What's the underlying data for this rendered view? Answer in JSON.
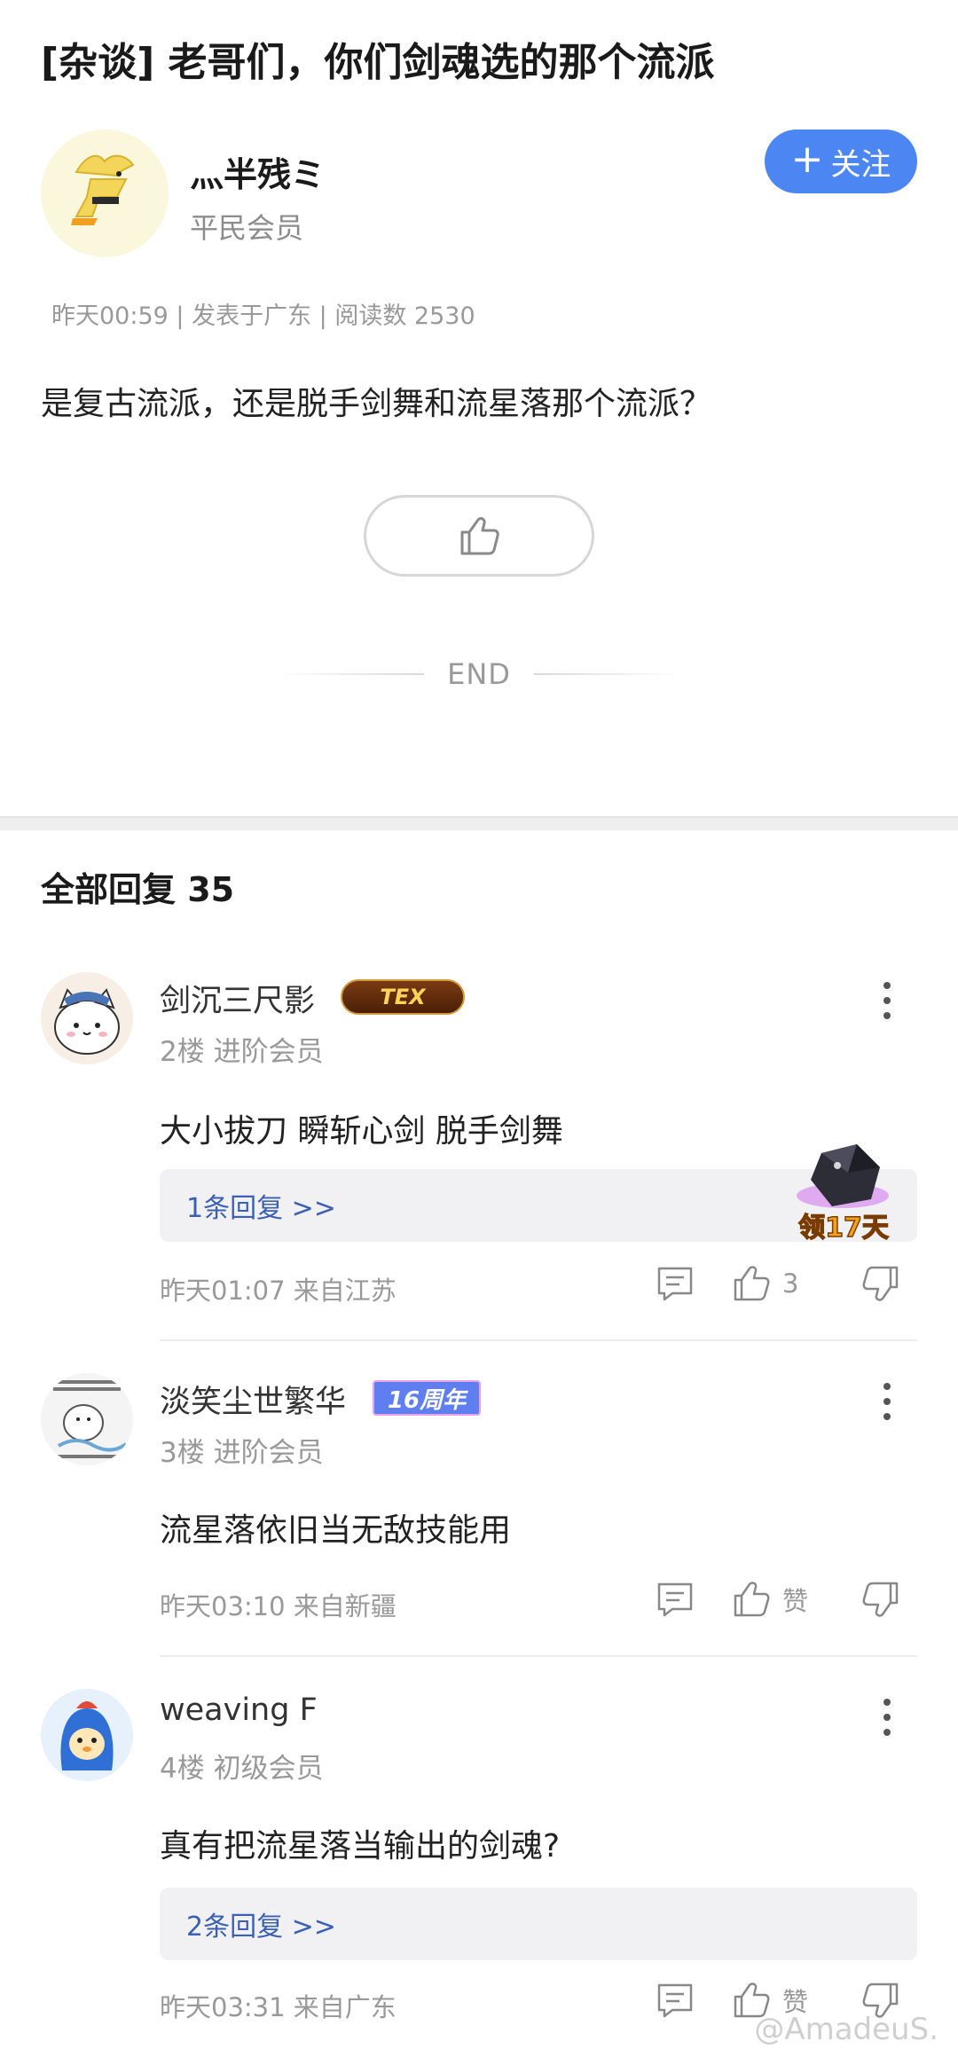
{
  "post": {
    "title": "[杂谈] 老哥们，你们剑魂选的那个流派",
    "author": {
      "name": "灬半残ミ",
      "level": "平民会员"
    },
    "follow_label": "关注",
    "meta": "昨天00:59 | 发表于广东 | 阅读数 2530",
    "body": "是复古流派，还是脱手剑舞和流星落那个流派？",
    "end_label": "END"
  },
  "replies": {
    "title": "全部回复  35",
    "comments": [
      {
        "name": "剑沉三尺影",
        "badge": "TEX",
        "floor": "2楼 进阶会员",
        "text": "大小拔刀 瞬斩心剑 脱手剑舞",
        "reply_link": "1条回复 >>",
        "time": "昨天01:07 来自江苏",
        "likes": "3"
      },
      {
        "name": "淡笑尘世繁华",
        "badge": "16周年",
        "floor": "3楼 进阶会员",
        "text": "流星落依旧当无敌技能用",
        "time": "昨天03:10 来自新疆",
        "likes": "赞"
      },
      {
        "name": "weaving F",
        "floor": "4楼 初级会员",
        "text": "真有把流星落当输出的剑魂?",
        "reply_link": "2条回复 >>",
        "time": "昨天03:31 来自广东",
        "likes": "赞"
      }
    ]
  },
  "promo": {
    "label": "领17天"
  },
  "watermark": "@AmadeuS.",
  "colors": {
    "accent": "#4b86f2",
    "link": "#3a5fb5",
    "muted": "#999999"
  }
}
